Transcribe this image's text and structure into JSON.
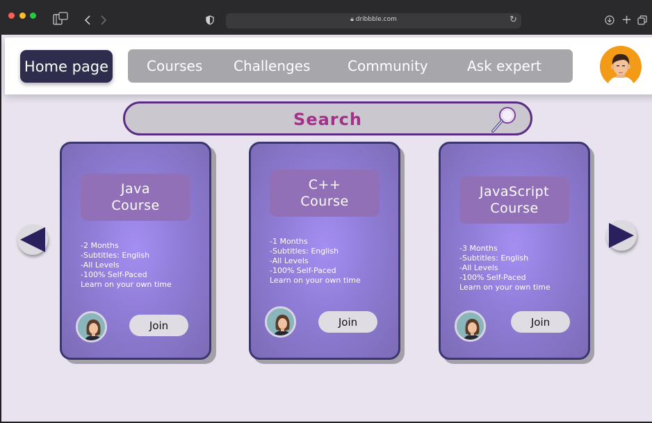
{
  "browser": {
    "url": "dribbble.com",
    "icons": [
      "sidebar-icon",
      "back-icon",
      "forward-icon",
      "shield-icon",
      "lock-icon",
      "reload-icon",
      "download-icon",
      "new-tab-icon",
      "tabs-icon"
    ]
  },
  "nav": {
    "home": "Home page",
    "items": [
      "Courses",
      "Challenges",
      "Community",
      "Ask expert"
    ]
  },
  "search": {
    "placeholder": "Search"
  },
  "courses": [
    {
      "title_line1": "Java",
      "title_line2": "Course",
      "details": [
        "-2 Months",
        "-Subtitles: English",
        "-All Levels",
        "-100% Self-Paced",
        "Learn on your own time"
      ],
      "join": "Join"
    },
    {
      "title_line1": "C++",
      "title_line2": "Course",
      "details": [
        "-1 Months",
        "-Subtitles: English",
        "-All Levels",
        "-100% Self-Paced",
        "Learn on your own time"
      ],
      "join": "Join"
    },
    {
      "title_line1": "JavaScript",
      "title_line2": "Course",
      "details": [
        "-3 Months",
        "-Subtitles: English",
        "-All Levels",
        "-100% Self-Paced",
        "Learn on your own time"
      ],
      "join": "Join"
    }
  ],
  "colors": {
    "nav_home_bg": "#2e2d4d",
    "nav_pill_bg": "#a7a6ab",
    "search_text": "#a4308c",
    "card_border": "#3b3670",
    "card_title_bg": "#9270b8",
    "arrow": "#2a205e"
  }
}
